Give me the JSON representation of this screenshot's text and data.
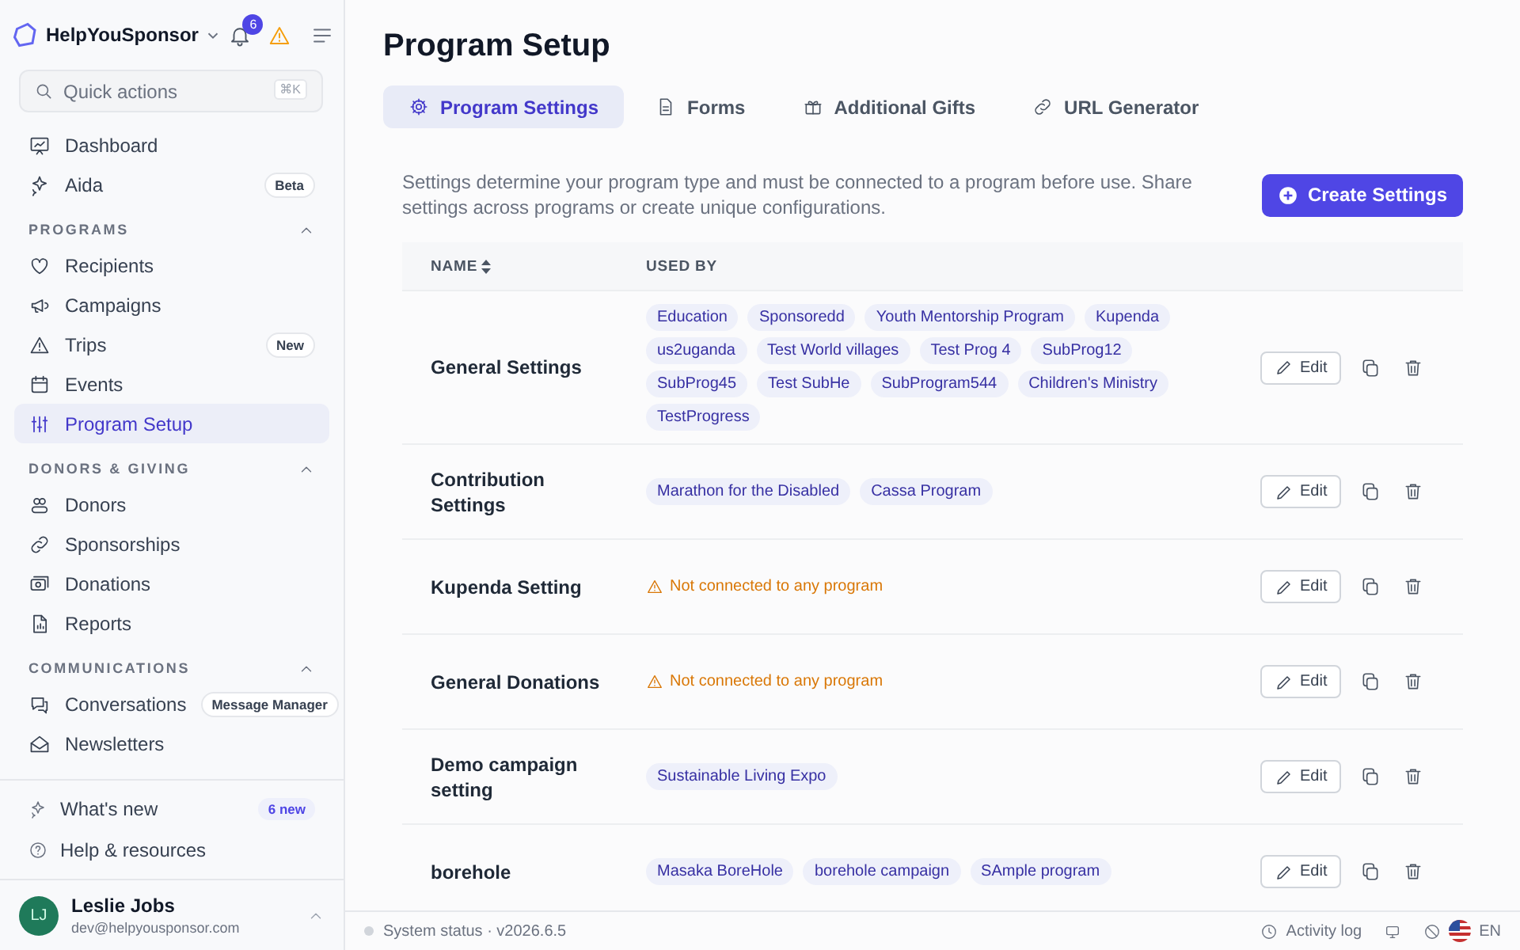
{
  "brand": {
    "name": "HelpYouSponsor",
    "notifications": "6"
  },
  "search": {
    "placeholder": "Quick actions",
    "shortcut": "⌘K"
  },
  "nav_top": [
    {
      "label": "Dashboard",
      "selected": false
    },
    {
      "label": "Aida",
      "badge": "Beta",
      "selected": false
    }
  ],
  "nav_sections": [
    {
      "title": "PROGRAMS",
      "expanded": true,
      "items": [
        {
          "label": "Recipients",
          "selected": false
        },
        {
          "label": "Campaigns",
          "selected": false
        },
        {
          "label": "Trips",
          "badge": "New",
          "selected": false
        },
        {
          "label": "Events",
          "selected": false
        },
        {
          "label": "Program Setup",
          "selected": true
        }
      ]
    },
    {
      "title": "DONORS & GIVING",
      "expanded": true,
      "items": [
        {
          "label": "Donors",
          "selected": false
        },
        {
          "label": "Sponsorships",
          "selected": false
        },
        {
          "label": "Donations",
          "selected": false
        },
        {
          "label": "Reports",
          "selected": false
        }
      ]
    },
    {
      "title": "COMMUNICATIONS",
      "expanded": true,
      "items": [
        {
          "label": "Conversations",
          "badge": "Message Manager",
          "selected": false
        },
        {
          "label": "Newsletters",
          "selected": false
        }
      ]
    }
  ],
  "footer_links": [
    {
      "label": "What's new",
      "badge": "6 new"
    },
    {
      "label": "Help & resources"
    }
  ],
  "user": {
    "initials": "LJ",
    "name": "Leslie Jobs",
    "email": "dev@helpyousponsor.com"
  },
  "page_title": "Program Setup",
  "tabs": [
    {
      "label": "Program Settings",
      "selected": true
    },
    {
      "label": "Forms",
      "selected": false
    },
    {
      "label": "Additional Gifts",
      "selected": false
    },
    {
      "label": "URL Generator",
      "selected": false
    }
  ],
  "description": "Settings determine your program type and must be connected to a program before use. Share settings across programs or create unique configurations.",
  "create_button": "Create Settings",
  "table": {
    "columns": [
      "NAME",
      "USED BY"
    ],
    "rows": [
      {
        "name": "General Settings",
        "used_by": [
          "Education",
          "Sponsoredd",
          "Youth Mentorship Program",
          "Kupenda",
          "us2uganda",
          "Test World villages",
          "Test Prog 4",
          "SubProg12",
          "SubProg45",
          "Test SubHe",
          "SubProgram544",
          "Children's Ministry",
          "TestProgress"
        ],
        "action": "Edit"
      },
      {
        "name": "Contribution Settings",
        "used_by": [
          "Marathon for the Disabled",
          "Cassa Program"
        ],
        "action": "Edit"
      },
      {
        "name": "Kupenda Setting",
        "warning": "Not connected to any program",
        "action": "Edit"
      },
      {
        "name": "General Donations",
        "warning": "Not connected to any program",
        "action": "Edit"
      },
      {
        "name": "Demo campaign setting",
        "used_by": [
          "Sustainable Living Expo"
        ],
        "action": "Edit"
      },
      {
        "name": "borehole",
        "used_by": [
          "Masaka BoreHole",
          "borehole campaign",
          "SAmple program"
        ],
        "action": "Edit"
      }
    ]
  },
  "status_bar": {
    "status": "System status · v2026.6.5",
    "activity": "Activity log",
    "language": "EN"
  }
}
